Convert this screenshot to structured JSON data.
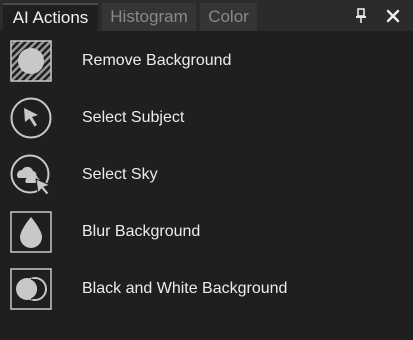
{
  "tabs": [
    {
      "label": "AI Actions",
      "active": true
    },
    {
      "label": "Histogram",
      "active": false
    },
    {
      "label": "Color",
      "active": false
    }
  ],
  "window_controls": {
    "pin_icon": "pin-icon",
    "close_icon": "close-icon"
  },
  "actions": [
    {
      "label": "Remove Background",
      "icon": "remove-background-icon"
    },
    {
      "label": "Select Subject",
      "icon": "select-subject-icon"
    },
    {
      "label": "Select Sky",
      "icon": "select-sky-icon"
    },
    {
      "label": "Blur Background",
      "icon": "blur-background-icon"
    },
    {
      "label": "Black and White Background",
      "icon": "black-and-white-background-icon"
    }
  ],
  "colors": {
    "panel_bg": "#1f1f1f",
    "tabbar_bg": "#2b2b2b",
    "text": "#ececec",
    "icon_stroke": "#c8c8c8"
  }
}
